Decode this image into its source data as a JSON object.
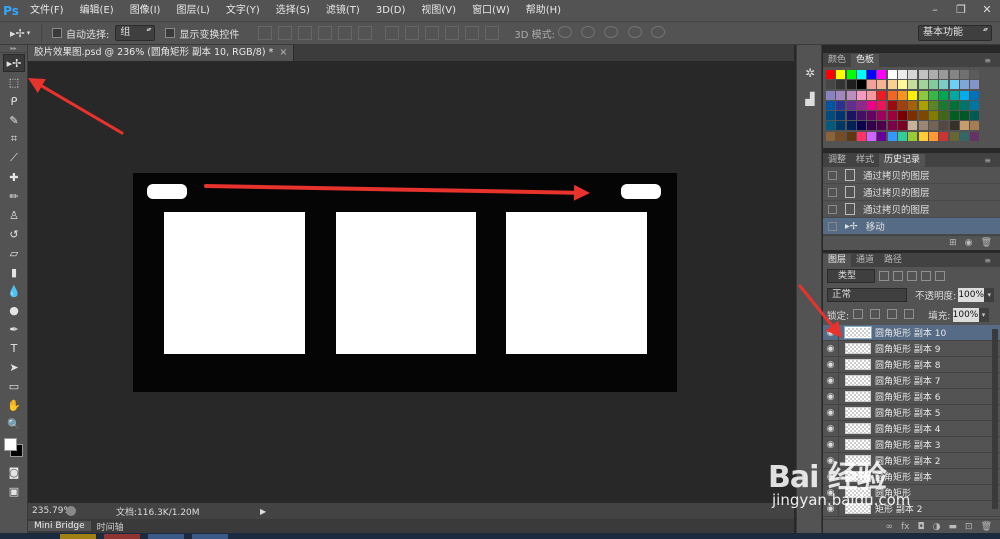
{
  "app": {
    "logo": "Ps",
    "menu": [
      "文件(F)",
      "编辑(E)",
      "图像(I)",
      "图层(L)",
      "文字(Y)",
      "选择(S)",
      "滤镜(T)",
      "3D(D)",
      "视图(V)",
      "窗口(W)",
      "帮助(H)"
    ],
    "window_controls": [
      "–",
      "❐",
      "✕"
    ]
  },
  "options": {
    "tool_icon": "move-tool-icon",
    "auto_select_label": "自动选择:",
    "auto_select_value": "组",
    "show_transform_label": "显示变换控件",
    "mode3d_label": "3D 模式:",
    "workspace": "基本功能"
  },
  "document": {
    "tab_label": "胶片效果图.psd @ 236% (圆角矩形 副本 10, RGB/8) *",
    "tab_close": "×",
    "background": "#050505",
    "frame_color": "#ffffff"
  },
  "status": {
    "zoom": "235.79%",
    "doc_info": "文档:116.3K/1.20M",
    "arrow": "▶"
  },
  "bottom_tabs": [
    "Mini Bridge",
    "时间轴"
  ],
  "color_panel": {
    "tabs": [
      "颜色",
      "色板"
    ],
    "active_tab": 1,
    "swatches": [
      "#ff0000",
      "#ffff00",
      "#00ff00",
      "#00ffff",
      "#0000ff",
      "#ff00ff",
      "#ffffff",
      "#ebebeb",
      "#d6d6d6",
      "#c2c2c2",
      "#adadad",
      "#999999",
      "#858585",
      "#707070",
      "#5c5c5c",
      "#474747",
      "#333333",
      "#1f1f1f",
      "#000000",
      "#f2a19a",
      "#f6b493",
      "#fbce92",
      "#fff799",
      "#c4df9b",
      "#a3d39c",
      "#82ca9c",
      "#7accc8",
      "#6dcff6",
      "#7ea7d8",
      "#8493ca",
      "#8882be",
      "#a187be",
      "#bc8dbf",
      "#f49ac2",
      "#f6989d",
      "#ed1c24",
      "#f26522",
      "#f7941d",
      "#fff200",
      "#8dc73f",
      "#39b54a",
      "#00a651",
      "#00a99d",
      "#00aeef",
      "#0072bc",
      "#0054a6",
      "#2e3192",
      "#662d91",
      "#92278f",
      "#ec008c",
      "#ed145b",
      "#9e0b0f",
      "#a0410d",
      "#a36209",
      "#aba000",
      "#598527",
      "#1a7b30",
      "#007236",
      "#00746b",
      "#0076a3",
      "#004b80",
      "#003471",
      "#1b1464",
      "#440e62",
      "#630460",
      "#9e005d",
      "#9e0039",
      "#790000",
      "#7b2e00",
      "#7d4900",
      "#827b00",
      "#406618",
      "#005e20",
      "#005826",
      "#005952",
      "#005b7f",
      "#003663",
      "#002157",
      "#0d004c",
      "#32004b",
      "#4b0049",
      "#7b0046",
      "#7a0026",
      "#c7b299",
      "#998675",
      "#736357",
      "#534741",
      "#37302a",
      "#c69c6d",
      "#a67c52",
      "#8c6239",
      "#754c24",
      "#603913",
      "#ff3366",
      "#cc66ff",
      "#660099",
      "#3399ff",
      "#33cc99",
      "#99cc33",
      "#ffcc33",
      "#ff9933",
      "#cc3333",
      "#666633",
      "#336666",
      "#663366"
    ]
  },
  "history_panel": {
    "tabs": [
      "调整",
      "样式",
      "历史记录"
    ],
    "active_tab": 2,
    "items": [
      {
        "label": "通过拷贝的图层",
        "selected": false
      },
      {
        "label": "通过拷贝的图层",
        "selected": false
      },
      {
        "label": "通过拷贝的图层",
        "selected": false
      },
      {
        "label": "移动",
        "selected": true
      }
    ]
  },
  "layers_panel": {
    "tabs": [
      "图层",
      "通道",
      "路径"
    ],
    "active_tab": 0,
    "filter_kind": "类型",
    "blend_mode": "正常",
    "opacity_label": "不透明度:",
    "opacity": "100%",
    "lock_label": "锁定:",
    "fill_label": "填充:",
    "fill": "100%",
    "layers": [
      {
        "name": "圆角矩形 副本 10",
        "selected": true
      },
      {
        "name": "圆角矩形 副本 9",
        "selected": false
      },
      {
        "name": "圆角矩形 副本 8",
        "selected": false
      },
      {
        "name": "圆角矩形 副本 7",
        "selected": false
      },
      {
        "name": "圆角矩形 副本 6",
        "selected": false
      },
      {
        "name": "圆角矩形 副本 5",
        "selected": false
      },
      {
        "name": "圆角矩形 副本 4",
        "selected": false
      },
      {
        "name": "圆角矩形 副本 3",
        "selected": false
      },
      {
        "name": "圆角矩形 副本 2",
        "selected": false
      },
      {
        "name": "圆角矩形 副本",
        "selected": false
      },
      {
        "name": "圆角矩形",
        "selected": false
      },
      {
        "name": "矩形 副本 2",
        "selected": false
      }
    ]
  },
  "watermark": {
    "brand": "Bai 经验",
    "url": "jingyan.baidu.com"
  },
  "annotations": {
    "arrow_color": "#e8322c"
  }
}
